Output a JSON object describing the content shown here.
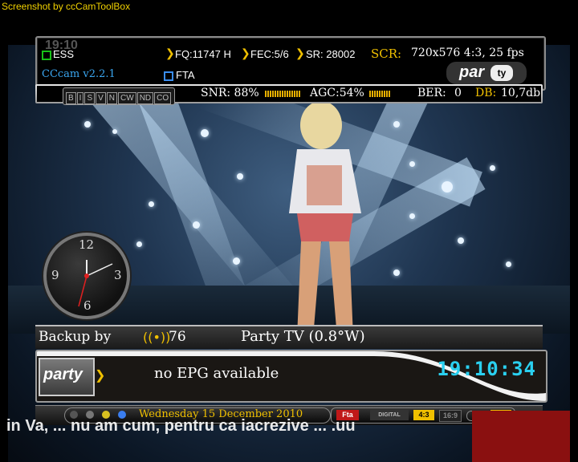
{
  "caption": "Screenshot by ccCamToolBox",
  "infobar": {
    "clock": "19:10",
    "encryption": "ESS",
    "emulator": "CCcam v2.2.1",
    "fta": "FTA",
    "frequency": "FQ:11747 H",
    "fec": "FEC:5/6",
    "symbol_rate": "SR: 28002",
    "scr_label": "SCR:",
    "scr_value": "720x576 4:3, 25 fps"
  },
  "statusbar": {
    "flags": [
      "B",
      "I",
      "S",
      "V",
      "N",
      "CW",
      "ND",
      "CO"
    ],
    "snr": "SNR: 88%",
    "snr_level": 0.88,
    "agc": "AGC:54%",
    "agc_level": 0.54,
    "ber_label": "BER:",
    "ber_value": "0",
    "db_label": "DB:",
    "db_value": "10,7db"
  },
  "analog_clock": {
    "numerals": [
      "12",
      "3",
      "6",
      "9"
    ]
  },
  "channelbar": {
    "backup": "Backup by",
    "signal_count": "76",
    "channel": "Party TV (0.8°W)"
  },
  "epg": {
    "logo": "party",
    "text": "no EPG available",
    "time": "19:10:34"
  },
  "bottombar": {
    "date": "Wednesday 15 December 2010",
    "badges": [
      "Fta",
      "DIGITAL",
      "4:3",
      "16:9"
    ]
  },
  "subtitle": "in Va, ... nu am cum, pentru ca iacrezive ... .uu",
  "colors": {
    "accent_yellow": "#f0c000",
    "digital_cyan": "#2ad0f0",
    "frame_gray": "#9a9a9a"
  }
}
